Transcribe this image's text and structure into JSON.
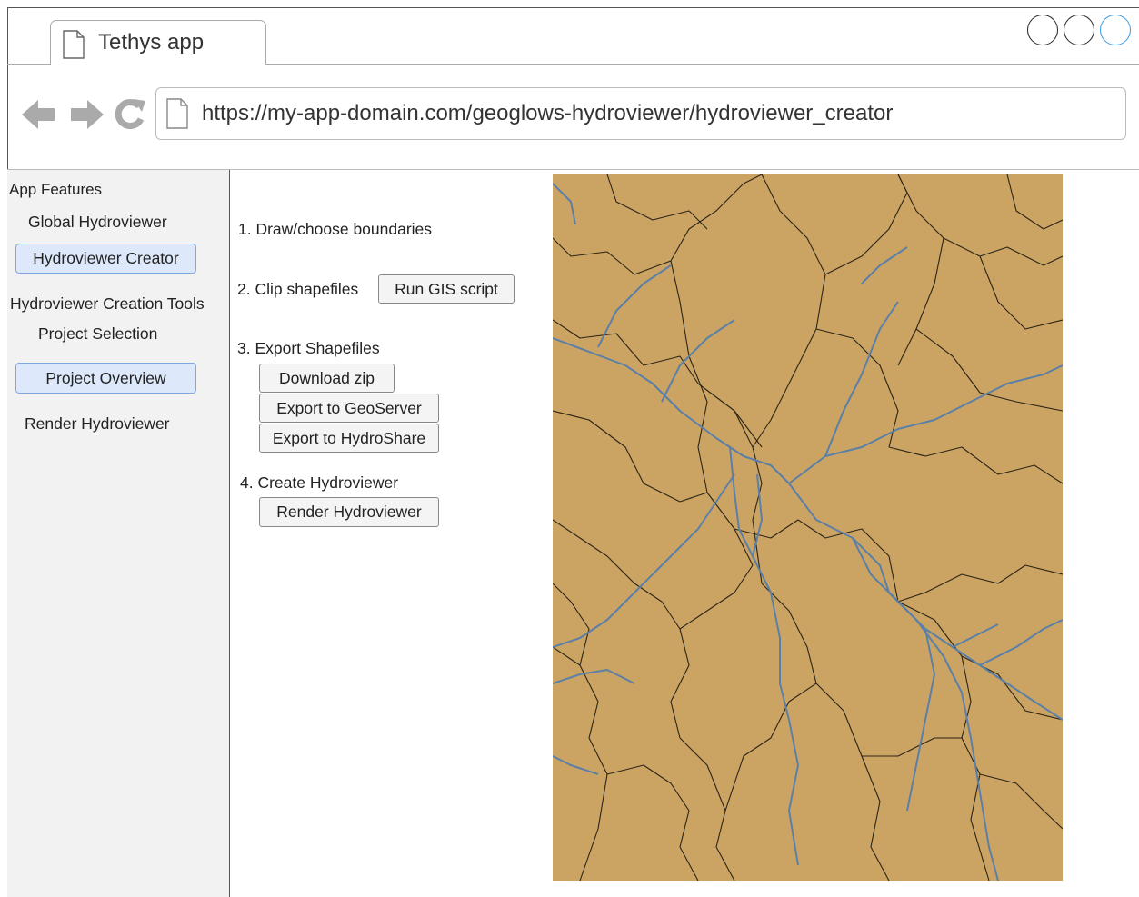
{
  "browser": {
    "tab_title": "Tethys app",
    "url": "https://my-app-domain.com/geoglows-hydroviewer/hydroviewer_creator"
  },
  "sidebar": {
    "heading": "App Features",
    "global_hydroviewer": "Global Hydroviewer",
    "hydroviewer_creator": "Hydroviewer Creator",
    "creation_tools": "Hydroviewer Creation Tools",
    "project_selection": "Project Selection",
    "project_overview": "Project Overview",
    "render_hydroviewer": "Render Hydroviewer"
  },
  "steps": {
    "step1": "1. Draw/choose boundaries",
    "step2": "2. Clip shapefiles",
    "run_gis_script": "Run GIS script",
    "step3": "3. Export Shapefiles",
    "download_zip": "Download zip",
    "export_geoserver": "Export to GeoServer",
    "export_hydroshare": "Export to HydroShare",
    "step4": "4. Create Hydroviewer",
    "render_hydroviewer": "Render Hydroviewer"
  },
  "colors": {
    "map_fill": "#cba464",
    "boundary": "#2b2416",
    "river": "#5b7fa6",
    "active_button": "#dde9fb",
    "window_button_active": "#3a9be0"
  },
  "icons": [
    "page-icon",
    "back-arrow-icon",
    "forward-arrow-icon",
    "reload-icon",
    "page-icon",
    "window-button-icon"
  ]
}
